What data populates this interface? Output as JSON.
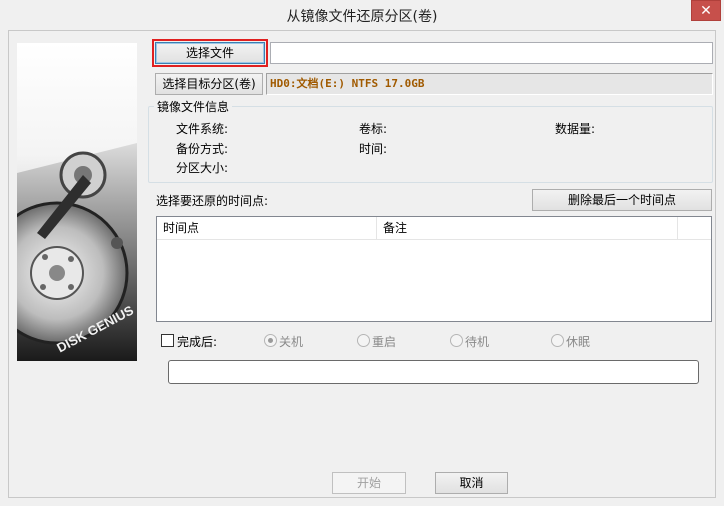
{
  "window": {
    "title": "从镜像文件还原分区(卷)",
    "close_glyph": "✕"
  },
  "source": {
    "select_file_label": "选择文件",
    "file_path_value": ""
  },
  "target": {
    "select_target_label": "选择目标分区(卷)",
    "target_value": "HD0:文档(E:) NTFS 17.0GB"
  },
  "image_info": {
    "legend": "镜像文件信息",
    "filesystem_label": "文件系统:",
    "volume_label": "卷标:",
    "data_size_label": "数据量:",
    "backup_method_label": "备份方式:",
    "time_label": "时间:",
    "partition_size_label": "分区大小:"
  },
  "timepoints": {
    "section_label": "选择要还原的时间点:",
    "delete_last_label": "删除最后一个时间点",
    "columns": [
      "时间点",
      "备注"
    ],
    "rows": []
  },
  "after_completion": {
    "checkbox_label": "完成后:",
    "checked": false,
    "options": [
      {
        "label": "关机",
        "selected": true
      },
      {
        "label": "重启",
        "selected": false
      },
      {
        "label": "待机",
        "selected": false
      },
      {
        "label": "休眠",
        "selected": false
      }
    ]
  },
  "progress": {
    "value": 0
  },
  "footer": {
    "start_label": "开始",
    "cancel_label": "取消"
  },
  "branding": {
    "logo_text": "DISK GENIUS"
  },
  "colors": {
    "target_text": "#a05a00",
    "focus_highlight": "#e02020",
    "close_button": "#c7504b"
  }
}
